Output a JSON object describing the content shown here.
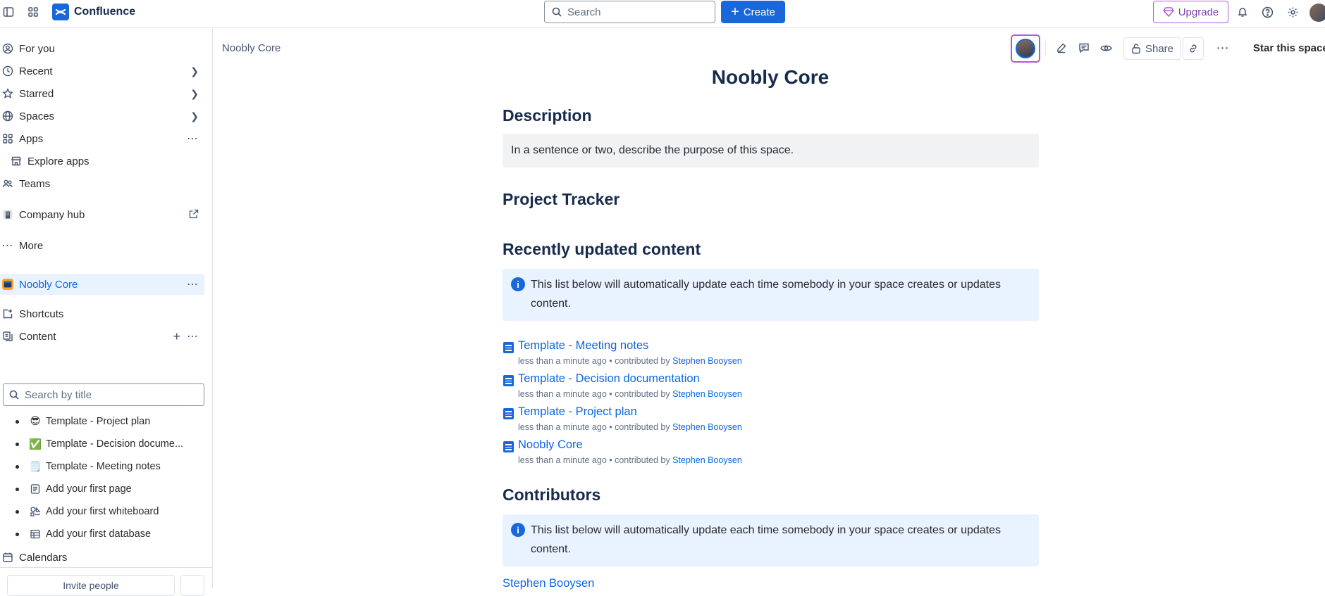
{
  "topbar": {
    "brand": "Confluence",
    "search_placeholder": "Search",
    "create_label": "Create",
    "upgrade_label": "Upgrade"
  },
  "sidebar": {
    "nav": [
      {
        "label": "For you",
        "icon": "person-icon"
      },
      {
        "label": "Recent",
        "icon": "clock-icon"
      },
      {
        "label": "Starred",
        "icon": "star-icon"
      },
      {
        "label": "Spaces",
        "icon": "globe-icon"
      },
      {
        "label": "Apps",
        "icon": "apps-icon"
      },
      {
        "label": "Explore apps",
        "icon": "store-icon"
      },
      {
        "label": "Teams",
        "icon": "teams-icon"
      },
      {
        "label": "Company hub",
        "icon": "building-icon"
      },
      {
        "label": "More",
        "icon": "more-icon"
      }
    ],
    "space": {
      "label": "Noobly Core"
    },
    "shortcuts_label": "Shortcuts",
    "content_label": "Content",
    "search_placeholder": "Search by title",
    "tree": [
      {
        "emoji": "😎",
        "label": "Template - Project plan"
      },
      {
        "emoji": "✅",
        "label": "Template - Decision docume..."
      },
      {
        "emoji": "🗒️",
        "label": "Template - Meeting notes"
      },
      {
        "emoji": "",
        "label": "Add your first page"
      },
      {
        "emoji": "",
        "label": "Add your first whiteboard"
      },
      {
        "emoji": "",
        "label": "Add your first database"
      }
    ],
    "calendars_label": "Calendars",
    "invite_label": "Invite people"
  },
  "page": {
    "breadcrumb": "Noobly Core",
    "share_label": "Share",
    "star_label": "Star this space",
    "title": "Noobly Core",
    "description_heading": "Description",
    "description_text": "In a sentence or two, describe the purpose of this space.",
    "tracker_heading": "Project Tracker",
    "recent_heading": "Recently updated content",
    "recent_info": "This list below will automatically update each time somebody in your space creates or updates content.",
    "recent_items": [
      {
        "title": "Template - Meeting notes",
        "meta": "less than a minute ago • contributed by ",
        "author": "Stephen Booysen"
      },
      {
        "title": "Template - Decision documentation",
        "meta": "less than a minute ago • contributed by ",
        "author": "Stephen Booysen"
      },
      {
        "title": "Template - Project plan",
        "meta": "less than a minute ago • contributed by ",
        "author": "Stephen Booysen"
      },
      {
        "title": "Noobly Core",
        "meta": "less than a minute ago • contributed by ",
        "author": "Stephen Booysen"
      }
    ],
    "contributors_heading": "Contributors",
    "contributors_info": "This list below will automatically update each time somebody in your space creates or updates content.",
    "contributors": [
      "Stephen Booysen"
    ]
  },
  "colors": {
    "accent": "#1868db",
    "upgrade": "#af59e1",
    "info_bg": "#e9f2ff"
  }
}
